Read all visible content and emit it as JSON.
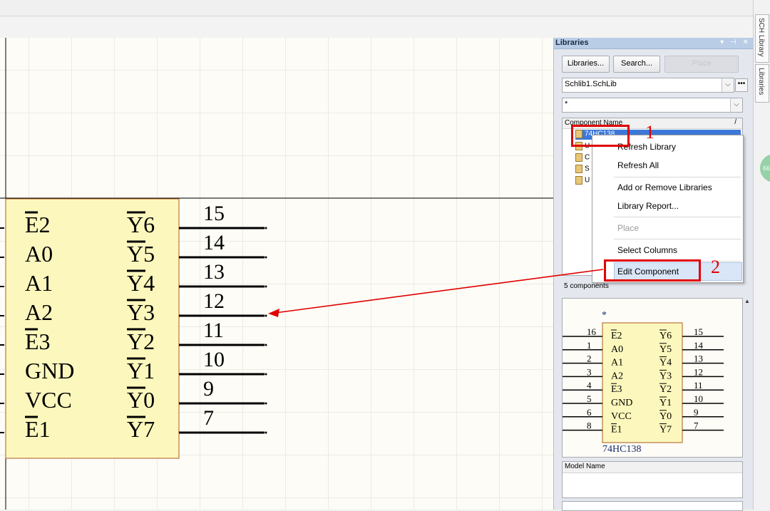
{
  "schematic": {
    "left_pins": [
      "E2",
      "A0",
      "A1",
      "A2",
      "E3",
      "GND",
      "VCC",
      "E1"
    ],
    "left_overbar": [
      true,
      false,
      false,
      false,
      true,
      false,
      false,
      true
    ],
    "right_pins": [
      "Y6",
      "Y5",
      "Y4",
      "Y3",
      "Y2",
      "Y1",
      "Y0",
      "Y7"
    ],
    "right_numbers": [
      "15",
      "14",
      "13",
      "12",
      "11",
      "10",
      "9",
      "7"
    ]
  },
  "libraries_panel": {
    "title": "Libraries",
    "libraries_button": "Libraries...",
    "search_button": "Search...",
    "place_button": "Place",
    "library_select": "Schlib1.SchLib",
    "filter_value": "*",
    "more_button": "•••",
    "column_component_name": "Component Name",
    "sort_indicator": "/",
    "tree_items": [
      "74HC138",
      "U",
      "C",
      "S",
      "U"
    ],
    "component_count": "5 components",
    "model_name_header": "Model Name"
  },
  "preview": {
    "marker": "*",
    "left_numbers": [
      "16",
      "1",
      "2",
      "3",
      "4",
      "5",
      "6",
      "8"
    ],
    "left_pins": [
      "E2",
      "A0",
      "A1",
      "A2",
      "E3",
      "GND",
      "VCC",
      "E1"
    ],
    "left_overbar": [
      true,
      false,
      false,
      false,
      true,
      false,
      false,
      true
    ],
    "right_pins": [
      "Y6",
      "Y5",
      "Y4",
      "Y3",
      "Y2",
      "Y1",
      "Y0",
      "Y7"
    ],
    "right_numbers": [
      "15",
      "14",
      "13",
      "12",
      "11",
      "10",
      "9",
      "7"
    ],
    "part_name": "74HC138"
  },
  "context_menu": {
    "refresh_library": "Refresh Library",
    "refresh_all": "Refresh All",
    "add_remove_libraries": "Add or Remove Libraries",
    "library_report": "Library Report...",
    "place": "Place",
    "select_columns": "Select Columns",
    "edit_component": "Edit Component"
  },
  "annotations": {
    "label_1": "1",
    "label_2": "2"
  },
  "side_tabs": [
    "SCH Library",
    "Libraries"
  ],
  "colors": {
    "annotation": "#e00000",
    "component_body": "#fcf8bd",
    "selection": "#3c78d8"
  }
}
